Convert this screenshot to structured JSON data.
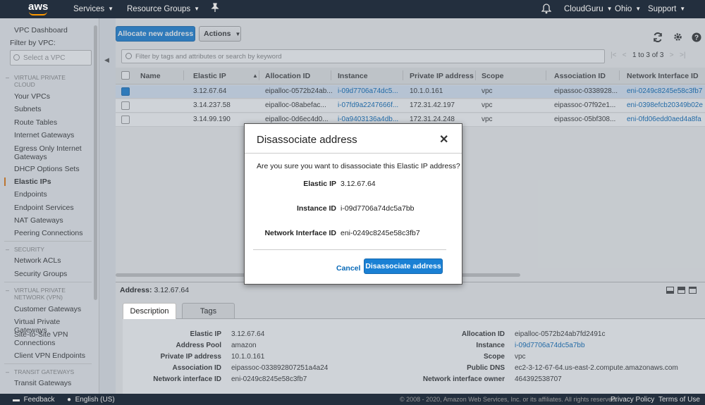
{
  "nav": {
    "logo": "aws",
    "services": "Services",
    "resource_groups": "Resource Groups",
    "account": "CloudGuru",
    "region": "Ohio",
    "support": "Support"
  },
  "sidebar": {
    "dashboard": "VPC Dashboard",
    "filter_label": "Filter by VPC:",
    "select_placeholder": "Select a VPC",
    "sections": [
      {
        "title": "VIRTUAL PRIVATE CLOUD",
        "items": [
          "Your VPCs",
          "Subnets",
          "Route Tables",
          "Internet Gateways",
          "Egress Only Internet Gateways",
          "DHCP Options Sets",
          "Elastic IPs",
          "Endpoints",
          "Endpoint Services",
          "NAT Gateways",
          "Peering Connections"
        ]
      },
      {
        "title": "SECURITY",
        "items": [
          "Network ACLs",
          "Security Groups"
        ]
      },
      {
        "title": "VIRTUAL PRIVATE NETWORK (VPN)",
        "items": [
          "Customer Gateways",
          "Virtual Private Gateways",
          "Site-to-Site VPN Connections",
          "Client VPN Endpoints"
        ]
      },
      {
        "title": "TRANSIT GATEWAYS",
        "items": [
          "Transit Gateways"
        ]
      }
    ],
    "active": "Elastic IPs"
  },
  "toolbar": {
    "allocate": "Allocate new address",
    "actions": "Actions",
    "filter_placeholder": "Filter by tags and attributes or search by keyword",
    "pager": "1 to 3 of 3"
  },
  "table": {
    "columns": [
      "Name",
      "Elastic IP",
      "Allocation ID",
      "Instance",
      "Private IP address",
      "Scope",
      "Association ID",
      "Network Interface ID"
    ],
    "rows": [
      {
        "selected": true,
        "name": "",
        "eip": "3.12.67.64",
        "alloc": "eipalloc-0572b24ab...",
        "instance": "i-09d7706a74dc5...",
        "private_ip": "10.1.0.161",
        "scope": "vpc",
        "assoc": "eipassoc-0338928...",
        "eni": "eni-0249c8245e58c3fb7"
      },
      {
        "selected": false,
        "name": "",
        "eip": "3.14.237.58",
        "alloc": "eipalloc-08abefac...",
        "instance": "i-07fd9a2247666f...",
        "private_ip": "172.31.42.197",
        "scope": "vpc",
        "assoc": "eipassoc-07f92e1...",
        "eni": "eni-0398efcb20349b02e"
      },
      {
        "selected": false,
        "name": "",
        "eip": "3.14.99.190",
        "alloc": "eipalloc-0d6ec4d0...",
        "instance": "i-0a9403136a4db...",
        "private_ip": "172.31.24.248",
        "scope": "vpc",
        "assoc": "eipassoc-05bf308...",
        "eni": "eni-0fd06edd0aed4a8fa"
      }
    ]
  },
  "details": {
    "address_label": "Address:",
    "address": "3.12.67.64",
    "tab_description": "Description",
    "tab_tags": "Tags",
    "left": [
      {
        "label": "Elastic IP",
        "value": "3.12.67.64"
      },
      {
        "label": "Address Pool",
        "value": "amazon"
      },
      {
        "label": "Private IP address",
        "value": "10.1.0.161"
      },
      {
        "label": "Association ID",
        "value": "eipassoc-033892807251a4a24"
      },
      {
        "label": "Network interface ID",
        "value": "eni-0249c8245e58c3fb7"
      }
    ],
    "right": [
      {
        "label": "Allocation ID",
        "value": "eipalloc-0572b24ab7fd2491c"
      },
      {
        "label": "Instance",
        "value": "i-09d7706a74dc5a7bb"
      },
      {
        "label": "Scope",
        "value": "vpc"
      },
      {
        "label": "Public DNS",
        "value": "ec2-3-12-67-64.us-east-2.compute.amazonaws.com"
      },
      {
        "label": "Network interface owner",
        "value": "464392538707"
      }
    ]
  },
  "modal": {
    "title": "Disassociate address",
    "question": "Are you sure you want to disassociate this Elastic IP address?",
    "fields": [
      {
        "label": "Elastic IP",
        "value": "3.12.67.64"
      },
      {
        "label": "Instance ID",
        "value": "i-09d7706a74dc5a7bb"
      },
      {
        "label": "Network Interface ID",
        "value": "eni-0249c8245e58c3fb7"
      }
    ],
    "cancel": "Cancel",
    "confirm": "Disassociate address"
  },
  "footer": {
    "feedback": "Feedback",
    "language": "English (US)",
    "copyright": "© 2008 - 2020, Amazon Web Services, Inc. or its affiliates. All rights reserved.",
    "privacy": "Privacy Policy",
    "terms": "Terms of Use"
  }
}
